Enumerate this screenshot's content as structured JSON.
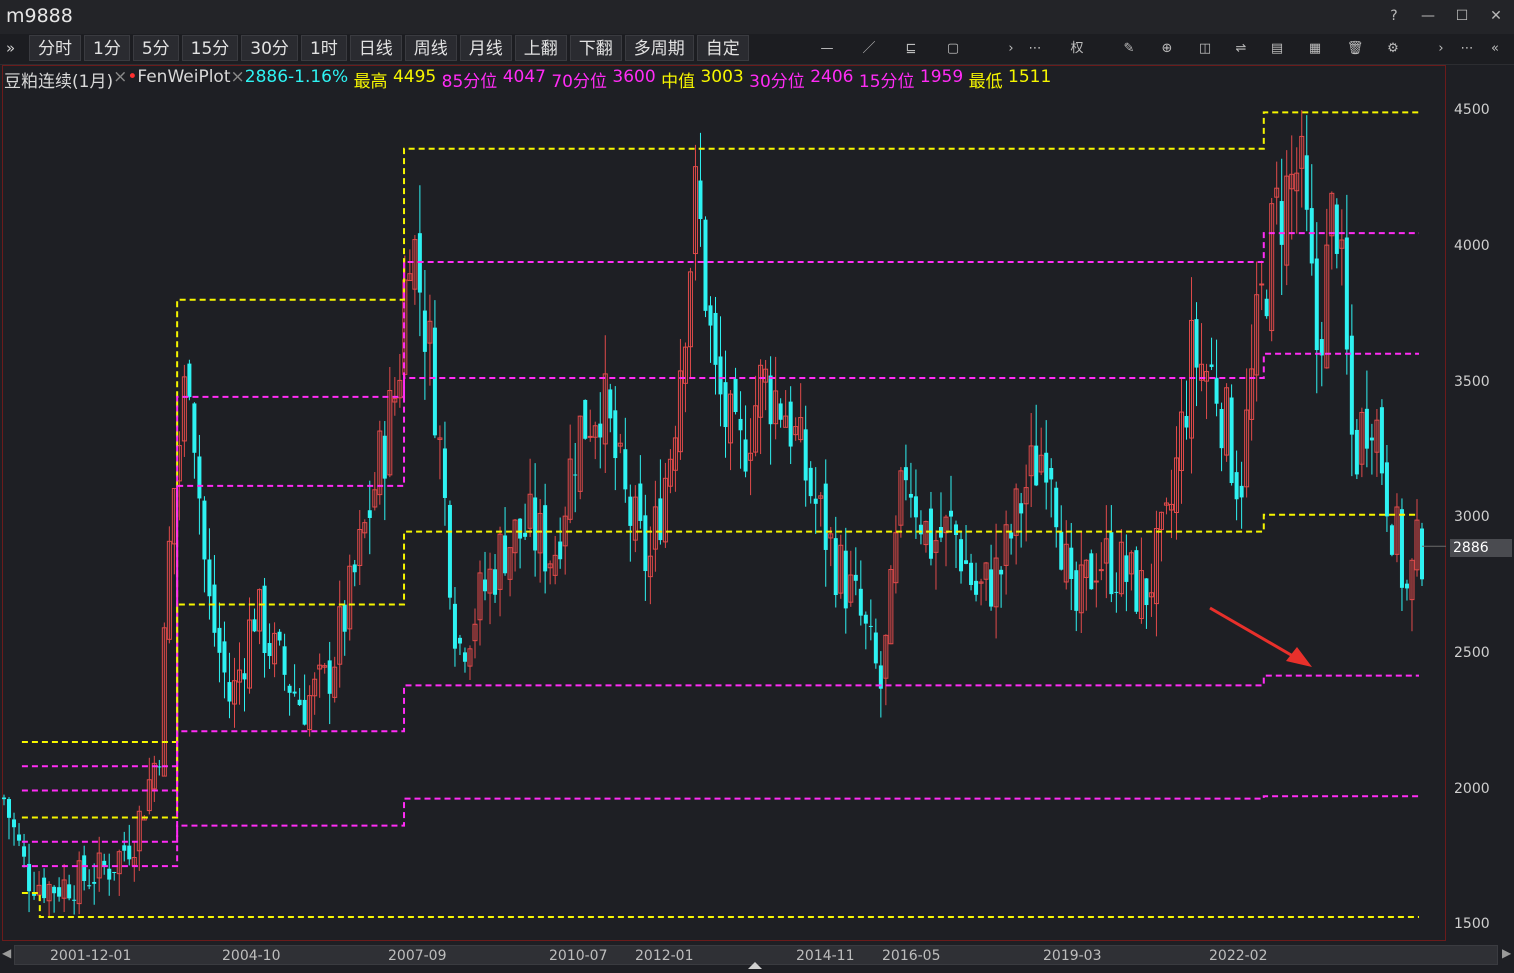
{
  "window": {
    "title": "m9888",
    "buttons": [
      "?",
      "—",
      "☐",
      "✕"
    ]
  },
  "toolbar": {
    "expand_icon": "»",
    "periods": [
      "分时",
      "1分",
      "5分",
      "15分",
      "30分",
      "1时",
      "日线",
      "周线",
      "月线",
      "上翻",
      "下翻",
      "多周期",
      "自定"
    ],
    "tools": [
      "horizontal-line-icon",
      "trend-line-icon",
      "drawing-icon",
      "window-icon",
      "chevron-right-icon",
      "more-icon",
      "rights-icon",
      "pen-icon",
      "download-icon",
      "camera-icon",
      "adjust-icon",
      "calculator-icon",
      "layout-icon",
      "delete-icon",
      "settings-icon",
      "chevron-right-icon",
      "more-icon",
      "collapse-icon"
    ],
    "tool_glyphs": [
      "—",
      "／",
      "⊑",
      "▢",
      "›",
      "⋯",
      "权",
      "✎",
      "⊕",
      "◫",
      "⇌",
      "▤",
      "▦",
      "🗑",
      "⚙",
      "›",
      "⋯",
      "«"
    ]
  },
  "legend": {
    "instrument": "豆粕连续(1月)",
    "close_x": "×",
    "dot": "•",
    "indicator": "FenWeiPlot",
    "close_x2": "×",
    "price_change": "2886-1.16%",
    "max_label": "最高",
    "max_value": "4495",
    "p85_label": "85分位",
    "p85_value": "4047",
    "p70_label": "70分位",
    "p70_value": "3600",
    "median_label": "中值",
    "median_value": "3003",
    "p30_label": "30分位",
    "p30_value": "2406",
    "p15_label": "15分位",
    "p15_value": "1959",
    "min_label": "最低",
    "min_value": "1511",
    "colors": {
      "cyan": "#2ef2f2",
      "yellow": "#f5f500",
      "magenta": "#ff2cf5",
      "red": "#e04a4a",
      "white": "#d8d8d8"
    }
  },
  "price_axis": {
    "ticks": [
      "4500",
      "4000",
      "3500",
      "3000",
      "2500",
      "2000",
      "1500"
    ],
    "last_price": "2886"
  },
  "time_axis": {
    "labels": [
      "2001-12-01",
      "2004-10",
      "2007-09",
      "2010-07",
      "2012-01",
      "2014-11",
      "2016-05",
      "2019-03",
      "2022-02"
    ]
  },
  "chart_data": {
    "type": "candlestick",
    "symbol": "m9888",
    "ylim": [
      1500,
      4500
    ],
    "percentile_bands": {
      "最高": [
        [
          2001.5,
          2160
        ],
        [
          2003.3,
          2160
        ],
        [
          2004.1,
          3800
        ],
        [
          2007.7,
          3800
        ],
        [
          2007.9,
          4360
        ],
        [
          2016.0,
          4360
        ],
        [
          2022.3,
          4495
        ]
      ],
      "85分位": [
        [
          2001.5,
          2070
        ],
        [
          2003.3,
          2070
        ],
        [
          2004.1,
          3440
        ],
        [
          2007.7,
          3440
        ],
        [
          2007.9,
          3940
        ],
        [
          2022.3,
          4047
        ]
      ],
      "70分位": [
        [
          2001.5,
          1980
        ],
        [
          2003.3,
          1980
        ],
        [
          2004.1,
          3110
        ],
        [
          2007.7,
          3110
        ],
        [
          2007.9,
          3510
        ],
        [
          2022.3,
          3600
        ]
      ],
      "中值": [
        [
          2001.5,
          1880
        ],
        [
          2003.3,
          1880
        ],
        [
          2004.1,
          2670
        ],
        [
          2007.7,
          2670
        ],
        [
          2007.9,
          2940
        ],
        [
          2022.3,
          3003
        ]
      ],
      "30分位": [
        [
          2001.5,
          1790
        ],
        [
          2003.3,
          1790
        ],
        [
          2004.1,
          2200
        ],
        [
          2007.7,
          2200
        ],
        [
          2007.9,
          2370
        ],
        [
          2022.3,
          2406
        ]
      ],
      "15分位": [
        [
          2001.5,
          1700
        ],
        [
          2003.3,
          1700
        ],
        [
          2004.1,
          1850
        ],
        [
          2007.7,
          1850
        ],
        [
          2007.9,
          1950
        ],
        [
          2022.3,
          1959
        ]
      ],
      "最低": [
        [
          2001.5,
          1600
        ],
        [
          2001.8,
          1511
        ],
        [
          2022.3,
          1511
        ]
      ]
    },
    "close_approx": [
      [
        2001.2,
        1950
      ],
      [
        2001.6,
        1660
      ],
      [
        2002.0,
        1620
      ],
      [
        2002.5,
        1650
      ],
      [
        2003.0,
        1700
      ],
      [
        2003.4,
        1820
      ],
      [
        2003.8,
        2150
      ],
      [
        2004.0,
        3000
      ],
      [
        2004.3,
        3600
      ],
      [
        2004.6,
        2700
      ],
      [
        2005.0,
        2300
      ],
      [
        2005.4,
        2650
      ],
      [
        2005.8,
        2450
      ],
      [
        2006.2,
        2300
      ],
      [
        2006.6,
        2380
      ],
      [
        2007.0,
        2700
      ],
      [
        2007.4,
        3100
      ],
      [
        2007.8,
        3500
      ],
      [
        2008.0,
        4100
      ],
      [
        2008.4,
        3500
      ],
      [
        2008.8,
        2500
      ],
      [
        2009.2,
        2700
      ],
      [
        2009.6,
        2900
      ],
      [
        2010.0,
        2950
      ],
      [
        2010.4,
        2850
      ],
      [
        2010.8,
        3300
      ],
      [
        2011.2,
        3450
      ],
      [
        2011.6,
        3050
      ],
      [
        2012.0,
        2800
      ],
      [
        2012.4,
        3300
      ],
      [
        2012.8,
        4200
      ],
      [
        2013.1,
        3500
      ],
      [
        2013.5,
        3200
      ],
      [
        2013.9,
        3500
      ],
      [
        2014.3,
        3400
      ],
      [
        2014.7,
        3100
      ],
      [
        2015.1,
        2850
      ],
      [
        2015.5,
        2650
      ],
      [
        2015.9,
        2350
      ],
      [
        2016.3,
        3200
      ],
      [
        2016.7,
        2900
      ],
      [
        2017.1,
        2950
      ],
      [
        2017.5,
        2700
      ],
      [
        2017.9,
        2800
      ],
      [
        2018.3,
        3100
      ],
      [
        2018.7,
        3300
      ],
      [
        2019.1,
        2600
      ],
      [
        2019.5,
        2850
      ],
      [
        2019.9,
        2800
      ],
      [
        2020.3,
        2700
      ],
      [
        2020.7,
        2950
      ],
      [
        2021.1,
        3600
      ],
      [
        2021.5,
        3500
      ],
      [
        2021.9,
        3100
      ],
      [
        2022.2,
        3700
      ],
      [
        2022.5,
        4100
      ],
      [
        2022.9,
        4300
      ],
      [
        2023.2,
        3600
      ],
      [
        2023.5,
        4200
      ],
      [
        2023.8,
        3200
      ],
      [
        2024.1,
        3450
      ],
      [
        2024.4,
        3050
      ],
      [
        2024.7,
        2700
      ],
      [
        2024.9,
        2886
      ]
    ],
    "last": 2886
  }
}
